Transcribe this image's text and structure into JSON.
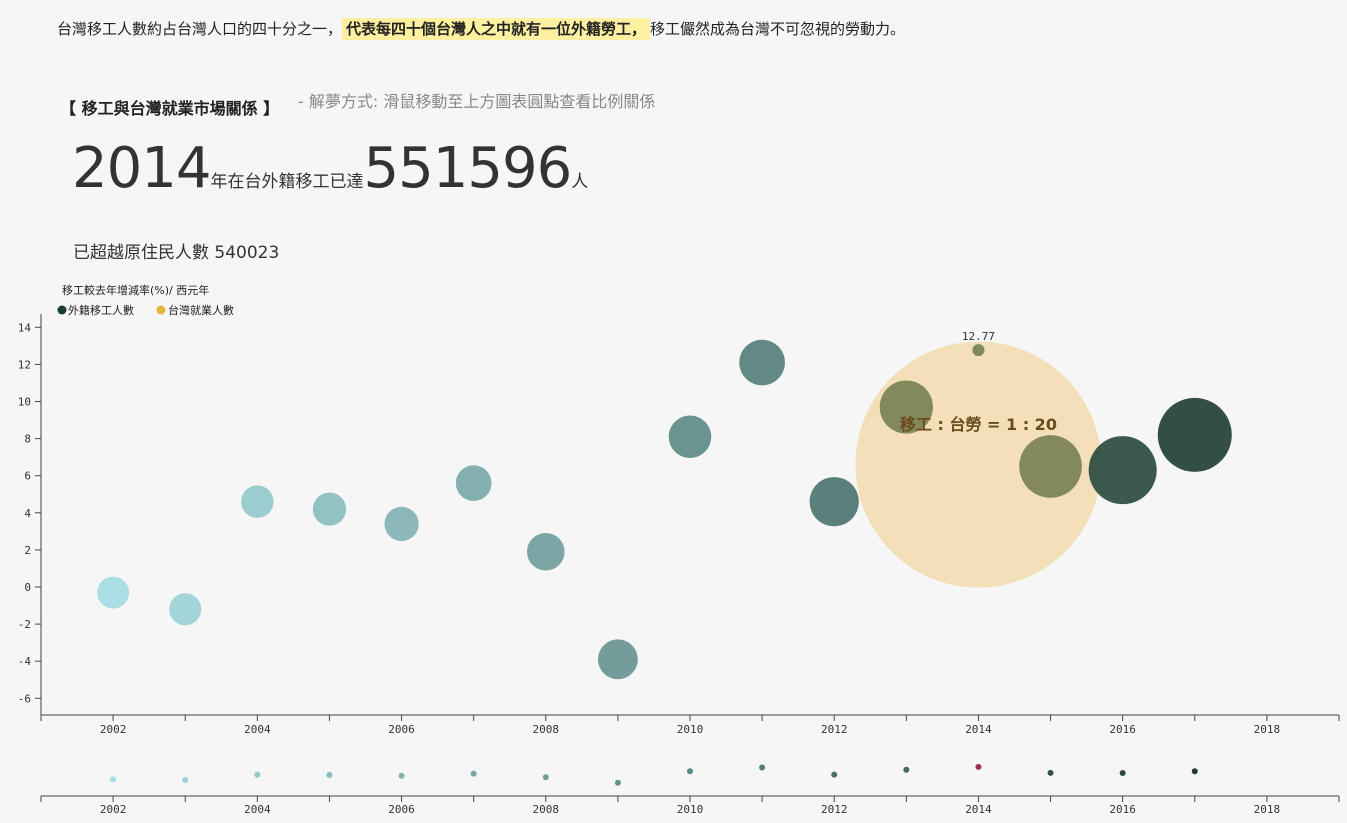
{
  "intro": {
    "part1": "台灣移工人數約占台灣人口的四十分之一，",
    "highlight": "代表每四十個台灣人之中就有一位外籍勞工，",
    "part2": "移工儼然成為台灣不可忽視的勞動力。"
  },
  "section": {
    "title": "【 移工與台灣就業市場關係 】",
    "hint": "- 解夢方式: 滑鼠移動至上方圖表圓點查看比例關係"
  },
  "headline": {
    "year": "2014",
    "text1": "年在台外籍移工已達",
    "count": "551596",
    "text2": "人"
  },
  "subline": "已超越原住民人數 540023",
  "colors": {
    "background": "#f6f6f6",
    "worker_dark": "#1e3d32",
    "taiwan_employed": "#e5b33f",
    "taiwan_bubble": "#f3ddb1",
    "ratio_text": "#6b4a1e",
    "selected_point": "#a0334d"
  },
  "chart_data": {
    "type": "scatter",
    "ylabel": "移工較去年增減率(%)/ 西元年",
    "legend": [
      "外籍移工人數",
      "台灣就業人數"
    ],
    "legend_position": "top-left",
    "x_ticks": [
      "2002",
      "2004",
      "2006",
      "2008",
      "2010",
      "2012",
      "2014",
      "2016",
      "2018"
    ],
    "y_ticks": [
      "14",
      "12",
      "10",
      "8",
      "6",
      "4",
      "2",
      "0",
      "-2",
      "-4",
      "-6"
    ],
    "xlim": [
      2001,
      2019
    ],
    "ylim": [
      -7,
      15
    ],
    "grid": false,
    "points": [
      {
        "year": 2002,
        "rate": -0.3,
        "workers": 303684
      },
      {
        "year": 2003,
        "rate": -1.2,
        "workers": 300150
      },
      {
        "year": 2004,
        "rate": 4.6,
        "workers": 314034
      },
      {
        "year": 2005,
        "rate": 4.2,
        "workers": 327396
      },
      {
        "year": 2006,
        "rate": 3.4,
        "workers": 338755
      },
      {
        "year": 2007,
        "rate": 5.6,
        "workers": 357937
      },
      {
        "year": 2008,
        "rate": 1.9,
        "workers": 365060
      },
      {
        "year": 2009,
        "rate": -3.9,
        "workers": 351016
      },
      {
        "year": 2010,
        "rate": 8.1,
        "workers": 379653
      },
      {
        "year": 2011,
        "rate": 12.1,
        "workers": 425660
      },
      {
        "year": 2012,
        "rate": 4.6,
        "workers": 445579
      },
      {
        "year": 2013,
        "rate": 9.7,
        "workers": 489134
      },
      {
        "year": 2014,
        "rate": 12.77,
        "workers": 551596
      },
      {
        "year": 2015,
        "rate": 6.5,
        "workers": 587940
      },
      {
        "year": 2016,
        "rate": 6.3,
        "workers": 624768
      },
      {
        "year": 2017,
        "rate": 8.2,
        "workers": 676142
      }
    ],
    "selected": {
      "year": 2014,
      "label": "12.77",
      "ratio_text": "移工 : 台勞 = 1 : 20"
    }
  }
}
